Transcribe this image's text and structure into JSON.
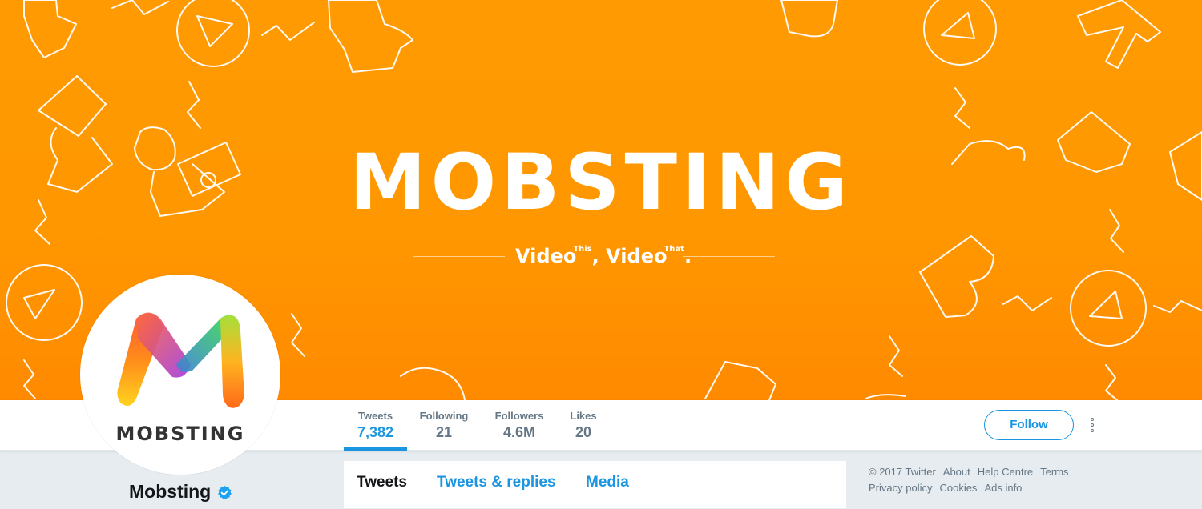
{
  "banner": {
    "brand": "MOBSTING",
    "tagline_word_1": "Video",
    "tagline_sup_1": "This",
    "tagline_word_2": "Video",
    "tagline_sup_2": "That",
    "background_color": "#ff9800"
  },
  "avatar": {
    "wordmark": "MOBSTING"
  },
  "profile": {
    "name": "Mobsting",
    "verified_icon": "verified-badge-icon"
  },
  "stats": [
    {
      "label": "Tweets",
      "value": "7,382"
    },
    {
      "label": "Following",
      "value": "21"
    },
    {
      "label": "Followers",
      "value": "4.6M"
    },
    {
      "label": "Likes",
      "value": "20"
    }
  ],
  "actions": {
    "follow_label": "Follow",
    "more_icon": "more-vertical-icon"
  },
  "timeline_tabs": [
    "Tweets",
    "Tweets & replies",
    "Media"
  ],
  "footer": {
    "copyright": "© 2017 Twitter",
    "links": [
      "About",
      "Help Centre",
      "Terms",
      "Privacy policy",
      "Cookies",
      "Ads info"
    ]
  },
  "colors": {
    "accent": "#1b95e0",
    "banner": "#ff9800",
    "text_dark": "#14171a",
    "text_muted": "#657786"
  }
}
